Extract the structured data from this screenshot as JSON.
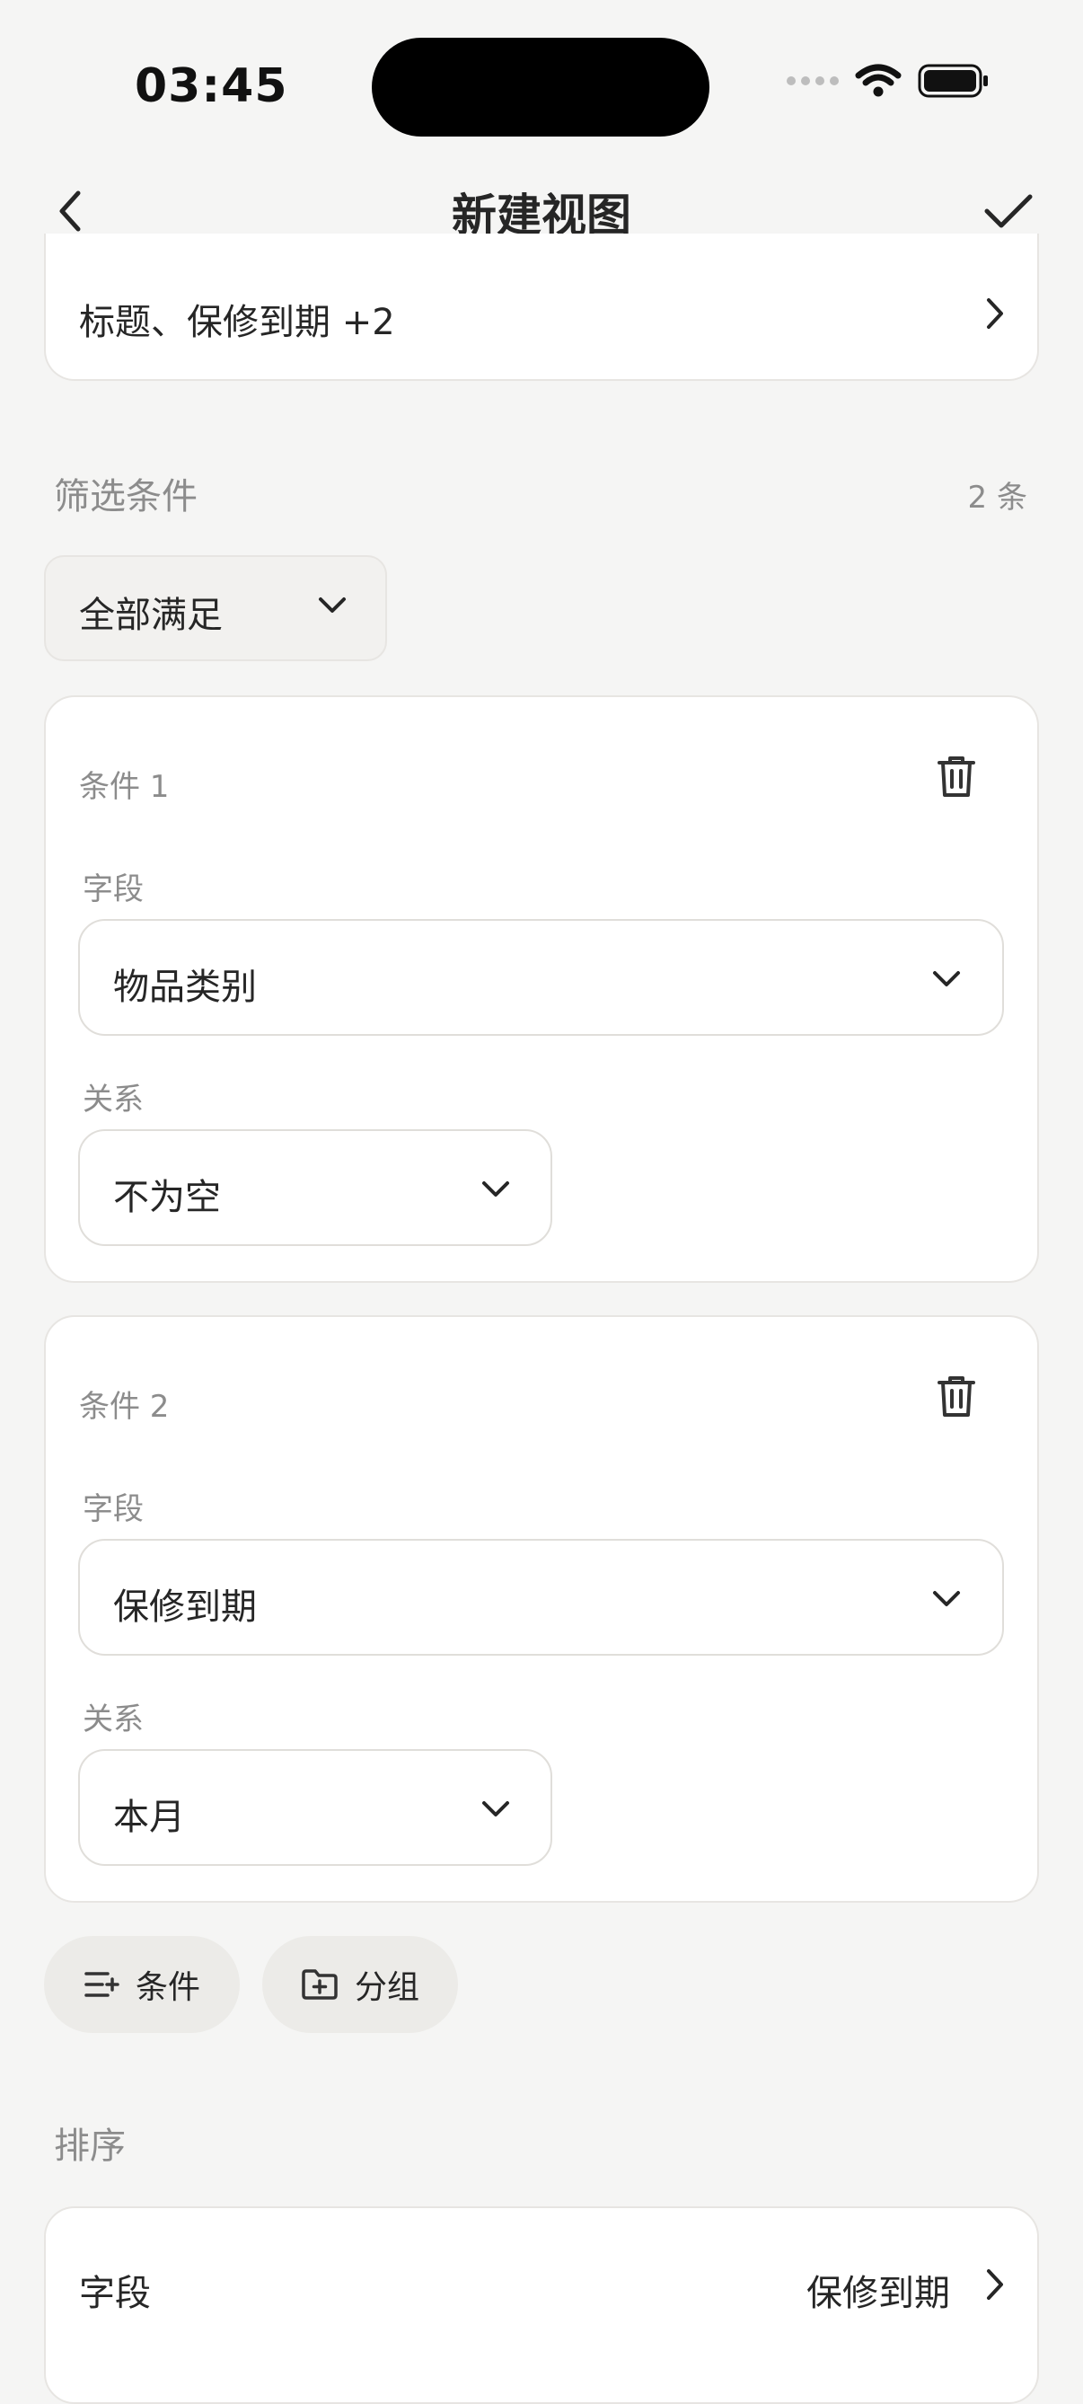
{
  "status_bar": {
    "time": "03:45",
    "icons": [
      "signal-dots",
      "wifi-icon",
      "battery-icon"
    ]
  },
  "nav": {
    "title": "新建视图",
    "back_icon": "chevron-left-icon",
    "done_icon": "checkmark-icon"
  },
  "fields_row": {
    "value": "标题、保修到期 +2"
  },
  "filter": {
    "label": "筛选条件",
    "count": "2 条",
    "match_mode": "全部满足",
    "conditions": [
      {
        "title": "条件 1",
        "field_label": "字段",
        "field_value": "物品类别",
        "relation_label": "关系",
        "relation_value": "不为空"
      },
      {
        "title": "条件 2",
        "field_label": "字段",
        "field_value": "保修到期",
        "relation_label": "关系",
        "relation_value": "本月"
      }
    ],
    "add_condition_label": "条件",
    "add_group_label": "分组"
  },
  "sort": {
    "label": "排序",
    "field_label": "字段",
    "field_value": "保修到期"
  },
  "colors": {
    "background": "#f5f5f4",
    "card": "#ffffff",
    "border": "#e7e5e2",
    "muted_text": "#8c8c8c",
    "pill": "#ecebe8"
  }
}
